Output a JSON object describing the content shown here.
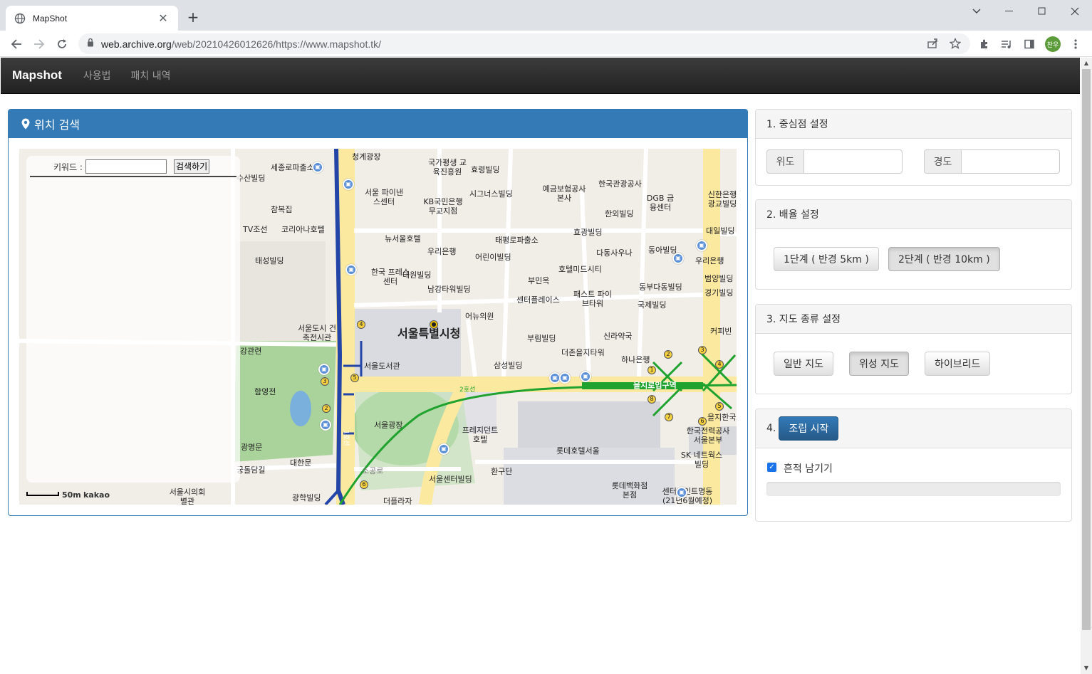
{
  "browser": {
    "tab_title": "MapShot",
    "tab_close": "✕",
    "new_tab": "+",
    "url_host": "web.archive.org",
    "url_path": "/web/20210426012626/https://www.mapshot.tk/",
    "profile_initials": "찬우"
  },
  "navbar": {
    "brand": "Mapshot",
    "links": [
      "사용법",
      "패치 내역"
    ]
  },
  "search_panel": {
    "title": "위치 검색",
    "keyword_label": "키워드 :",
    "keyword_value": "",
    "search_button": "검색하기"
  },
  "map": {
    "scale_label": "50m",
    "provider": "kakao",
    "labels": {
      "city_hall": "서울특별시청",
      "plaza": "서울광장",
      "library": "서울도서관",
      "euljiro": "을지로입구역",
      "line2": "2호선",
      "line1": "1호선",
      "cheonggye": "청계광장",
      "sejong": "세종로파출소",
      "sanbilding": "수산빌딩",
      "chambokjip": "참복집",
      "tvjoseon": "TV조선",
      "koreana": "코리아나호텔",
      "taesung": "태성빌딩",
      "archive": "서울도시 건축전시관",
      "hangwan": "강관련",
      "hamyeong": "함영전",
      "gwangmyeong": "광명문",
      "daehanmun": "대한문",
      "gungdamgil": "궁돌담길",
      "seoul_council": "서울시의회 별관",
      "gwanghak": "광학빌딩",
      "finance_center": "서울 파이낸스센터",
      "kb": "KB국민은행 무교지점",
      "signature": "시그너스빌딩",
      "national": "국가평생 교육진흥원",
      "hyoryeong": "효령빌딩",
      "deposit": "예금보험공사 본사",
      "kto": "한국관광공사",
      "dgb": "DGB 금융센터",
      "shinhan": "신한은행 광교빌딩",
      "hanoe": "한외빌딩",
      "newseoul": "뉴서울호텔",
      "woori1": "우리은행",
      "taepyeong": "태평로파출소",
      "hyokwang": "효광빌딩",
      "daeil": "대일빌딩",
      "dong_a": "동아빌딩",
      "woori2": "우리은행",
      "presscenter": "한국 프레스센터",
      "daewon": "대원빌딩",
      "eorini": "어린이빌딩",
      "bumin": "부민옥",
      "hotelmidcity": "호텔미드시티",
      "dadong": "다동사우나",
      "beomyang": "범양빌딩",
      "gyeongki": "경기빌딩",
      "namgang": "남강타워빌딩",
      "centerplace": "센터플레이스",
      "fast_five": "패스트 파이브타워",
      "dongbu": "동부다동빌딩",
      "gukje": "국제빌딩",
      "eonyu": "어뉴의원",
      "silla": "신라약국",
      "burim": "부림빌딩",
      "coffee": "커피빈",
      "eulji_tower": "더존을지타워",
      "hana": "하나은행",
      "samseong": "삼성빌딩",
      "president": "프레지던트 호텔",
      "lotte_hotel": "롯데호텔서울",
      "kepco": "한국전력공사 서울본부",
      "sk": "SK 네트웍스빌딩",
      "euljihanguk": "을지한국",
      "hwangudan": "환구단",
      "seoul_center": "서울센터빌딩",
      "lotte_dept": "롯데백화점 본점",
      "myeongdong": "센터포인트명동 (21년6월예정)",
      "thepl": "더플라자",
      "sogong": "소공로"
    }
  },
  "settings": {
    "center": {
      "title": "1. 중심점 설정",
      "lat_label": "위도",
      "lng_label": "경도",
      "lat_value": "",
      "lng_value": ""
    },
    "zoom": {
      "title": "2. 배율 설정",
      "options": [
        "1단계 ( 반경 5km )",
        "2단계 ( 반경 10km )"
      ],
      "selected": 1
    },
    "maptype": {
      "title": "3. 지도 종류 설정",
      "options": [
        "일반 지도",
        "위성 지도",
        "하이브리드"
      ],
      "selected": 1
    },
    "build": {
      "prefix": "4.",
      "button": "조립 시작",
      "trace_label": "흔적 남기기",
      "trace_checked": true,
      "progress": 0
    }
  },
  "colors": {
    "primary": "#337ab7",
    "line2_green": "#1fa22e",
    "line1_blue": "#2445a8",
    "road_yellow": "#fbe9a0"
  }
}
